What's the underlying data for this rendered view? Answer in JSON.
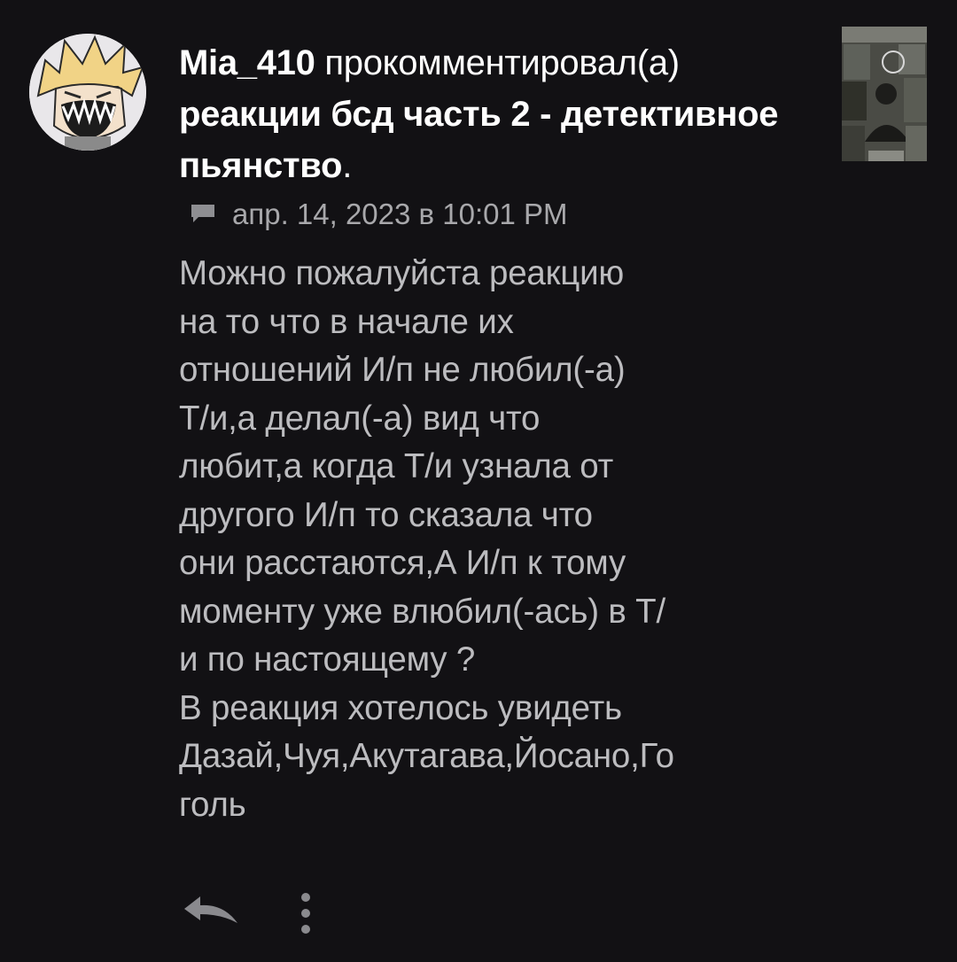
{
  "notification": {
    "username": "Mia_410",
    "action": "прокомментировал(а)",
    "post_title": "реакции бсд часть 2 - детективное пьянство",
    "post_title_suffix": "."
  },
  "meta": {
    "icon": "comment-icon",
    "timestamp": "апр. 14, 2023 в 10:01 PM"
  },
  "comment": {
    "text": "Можно пожалуйста реакцию\nна то что в начале их\nотношений И/п не любил(-а)\nТ/и,а делал(-а) вид что\nлюбит,а когда Т/и узнала от\nдругого И/п то сказала что\nони расстаются,А И/п к тому\nмоменту уже влюбил(-ась) в Т/\nи по настоящему ?\nВ реакция хотелось увидеть\nДазай,Чуя,Акутагава,Йосано,Го\nголь"
  },
  "actions": {
    "reply_icon": "reply-arrow-icon",
    "more_icon": "more-vertical-icon"
  },
  "colors": {
    "background": "#121114",
    "title_text": "#ffffff",
    "body_text": "#bcbcbf",
    "meta_text": "#a8a8ab"
  }
}
